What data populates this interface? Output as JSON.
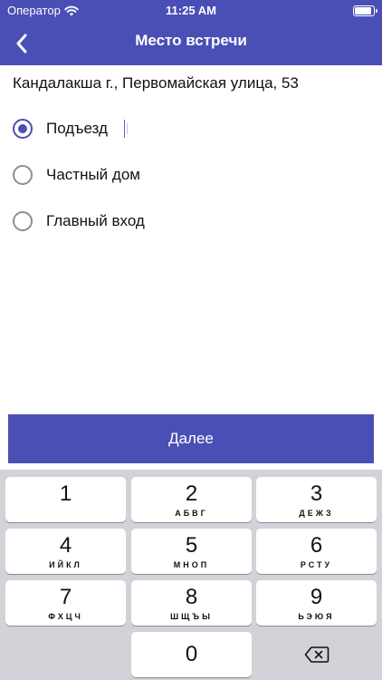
{
  "status_bar": {
    "carrier": "Оператор",
    "time": "11:25 AM"
  },
  "navbar": {
    "title": "Место встречи",
    "back_icon": "chevron-left-icon"
  },
  "address": "Кандалакша г., Первомайская улица, 53",
  "options": [
    {
      "label": "Подъезд",
      "selected": true
    },
    {
      "label": "Частный дом",
      "selected": false
    },
    {
      "label": "Главный вход",
      "selected": false
    }
  ],
  "next_button": {
    "label": "Далее"
  },
  "keyboard": {
    "keys": [
      {
        "digit": "1",
        "letters": ""
      },
      {
        "digit": "2",
        "letters": "АБВГ"
      },
      {
        "digit": "3",
        "letters": "ДЕЖЗ"
      },
      {
        "digit": "4",
        "letters": "ИЙКЛ"
      },
      {
        "digit": "5",
        "letters": "МНОП"
      },
      {
        "digit": "6",
        "letters": "РСТУ"
      },
      {
        "digit": "7",
        "letters": "ФХЦЧ"
      },
      {
        "digit": "8",
        "letters": "ШЩЪЫ"
      },
      {
        "digit": "9",
        "letters": "ЬЭЮЯ"
      },
      {
        "digit": "0",
        "letters": ""
      }
    ],
    "delete_icon": "backspace-icon"
  },
  "colors": {
    "accent": "#4a4fb5",
    "keyboard_bg": "#d1d3d9",
    "radio_unselected": "#8e8e8e"
  }
}
